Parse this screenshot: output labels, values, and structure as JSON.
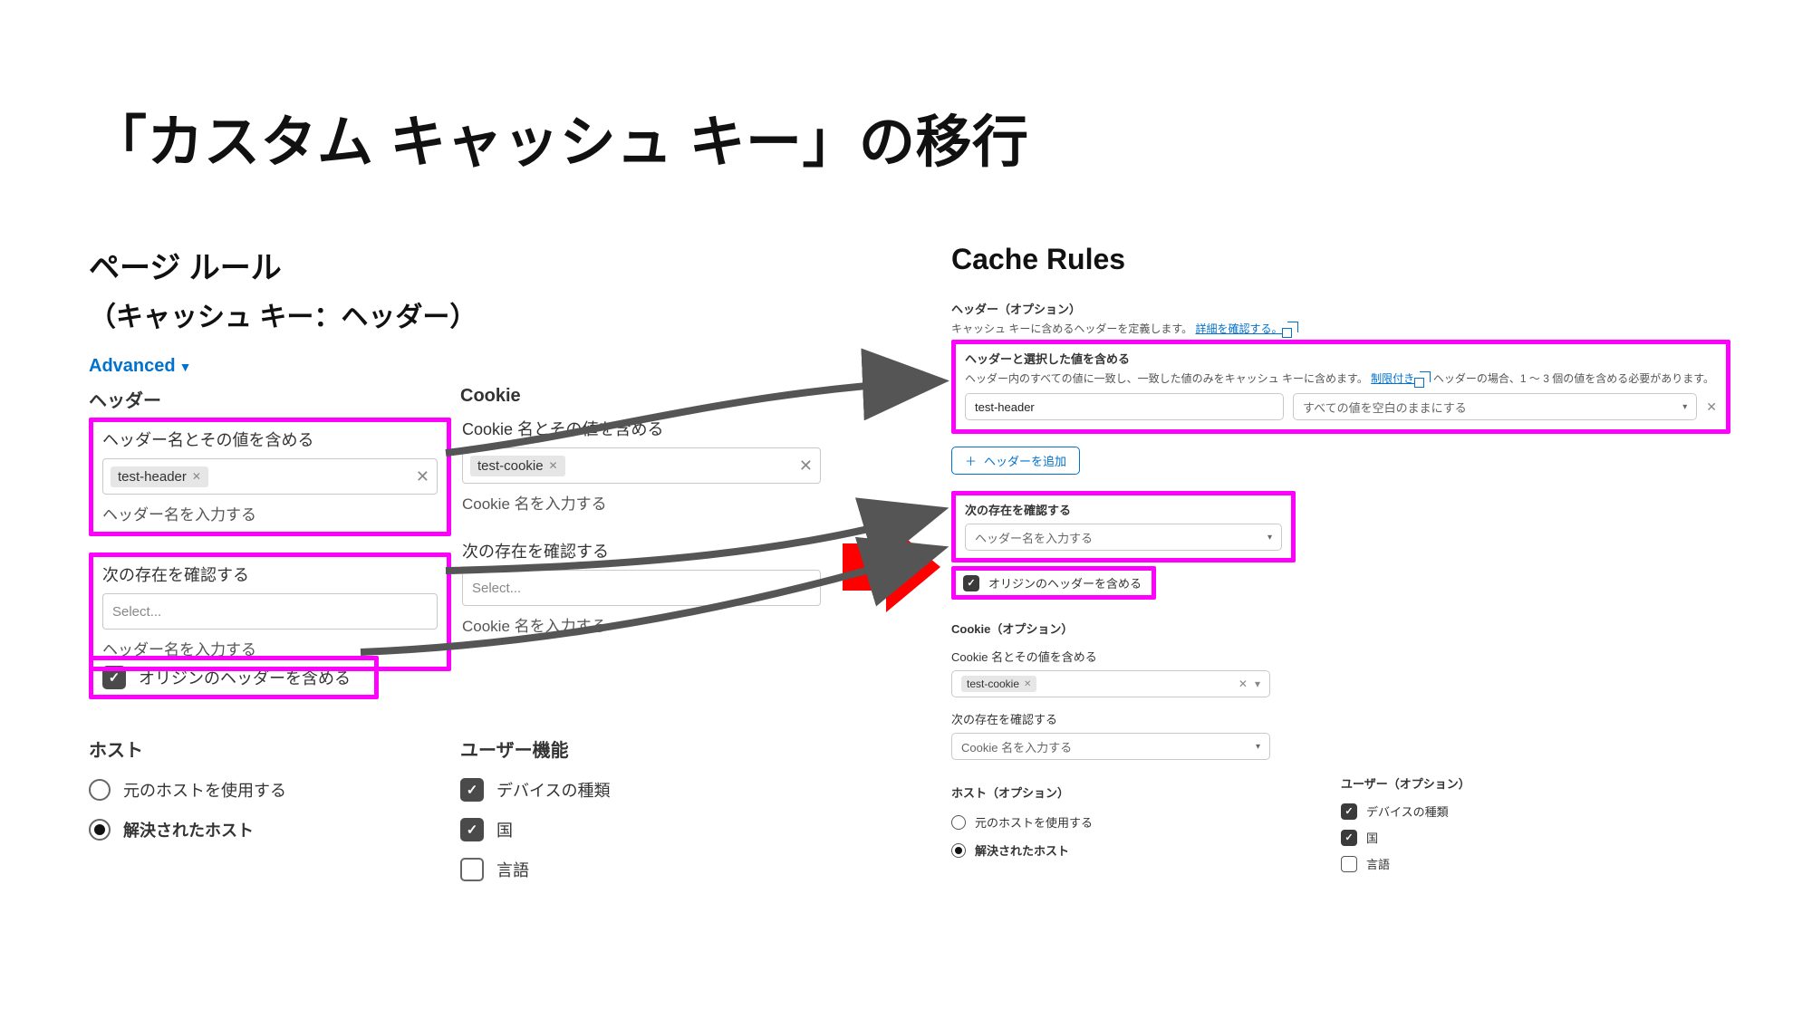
{
  "title": "「カスタム キャッシュ キー」の移行",
  "left": {
    "heading": "ページ ルール",
    "subheading": "（キャッシュ キー：ヘッダー）",
    "advanced_link": "Advanced",
    "header_col": {
      "title": "ヘッダー",
      "include_caption": "ヘッダー名とその値を含める",
      "chip": "test-header",
      "include_help": "ヘッダー名を入力する",
      "exists_caption": "次の存在を確認する",
      "exists_placeholder": "Select...",
      "exists_help": "ヘッダー名を入力する",
      "origin_checkbox": "オリジンのヘッダーを含める"
    },
    "cookie_col": {
      "title": "Cookie",
      "include_caption": "Cookie 名とその値を含める",
      "chip": "test-cookie",
      "include_help": "Cookie 名を入力する",
      "exists_caption": "次の存在を確認する",
      "exists_placeholder": "Select...",
      "exists_help": "Cookie 名を入力する"
    },
    "host": {
      "title": "ホスト",
      "use_origin": "元のホストを使用する",
      "resolved": "解決されたホスト"
    },
    "user_features": {
      "title": "ユーザー機能",
      "device": "デバイスの種類",
      "country": "国",
      "language": "言語"
    }
  },
  "right": {
    "heading": "Cache Rules",
    "header_opt_title": "ヘッダー（オプション）",
    "header_opt_desc_a": "キャッシュ キーに含めるヘッダーを定義します。",
    "header_opt_desc_link": "詳細を確認する。",
    "include_title": "ヘッダーと選択した値を含める",
    "include_desc_a": "ヘッダー内のすべての値に一致し、一致した値のみをキャッシュ キーに含めます。",
    "include_desc_link": "制限付き",
    "include_desc_b": " ヘッダーの場合、1 〜 3 個の値を含める必要があります。",
    "header_name_value": "test-header",
    "values_placeholder": "すべての値を空白のままにする",
    "add_header_btn": "ヘッダーを追加",
    "exists_title": "次の存在を確認する",
    "exists_placeholder": "ヘッダー名を入力する",
    "origin_checkbox": "オリジンのヘッダーを含める",
    "cookie_opt_title": "Cookie（オプション）",
    "cookie_include_caption": "Cookie 名とその値を含める",
    "cookie_chip": "test-cookie",
    "cookie_exists_caption": "次の存在を確認する",
    "cookie_exists_placeholder": "Cookie 名を入力する",
    "host_title": "ホスト（オプション）",
    "host_use_origin": "元のホストを使用する",
    "host_resolved": "解決されたホスト",
    "user_title": "ユーザー（オプション）",
    "user_device": "デバイスの種類",
    "user_country": "国",
    "user_language": "言語"
  }
}
